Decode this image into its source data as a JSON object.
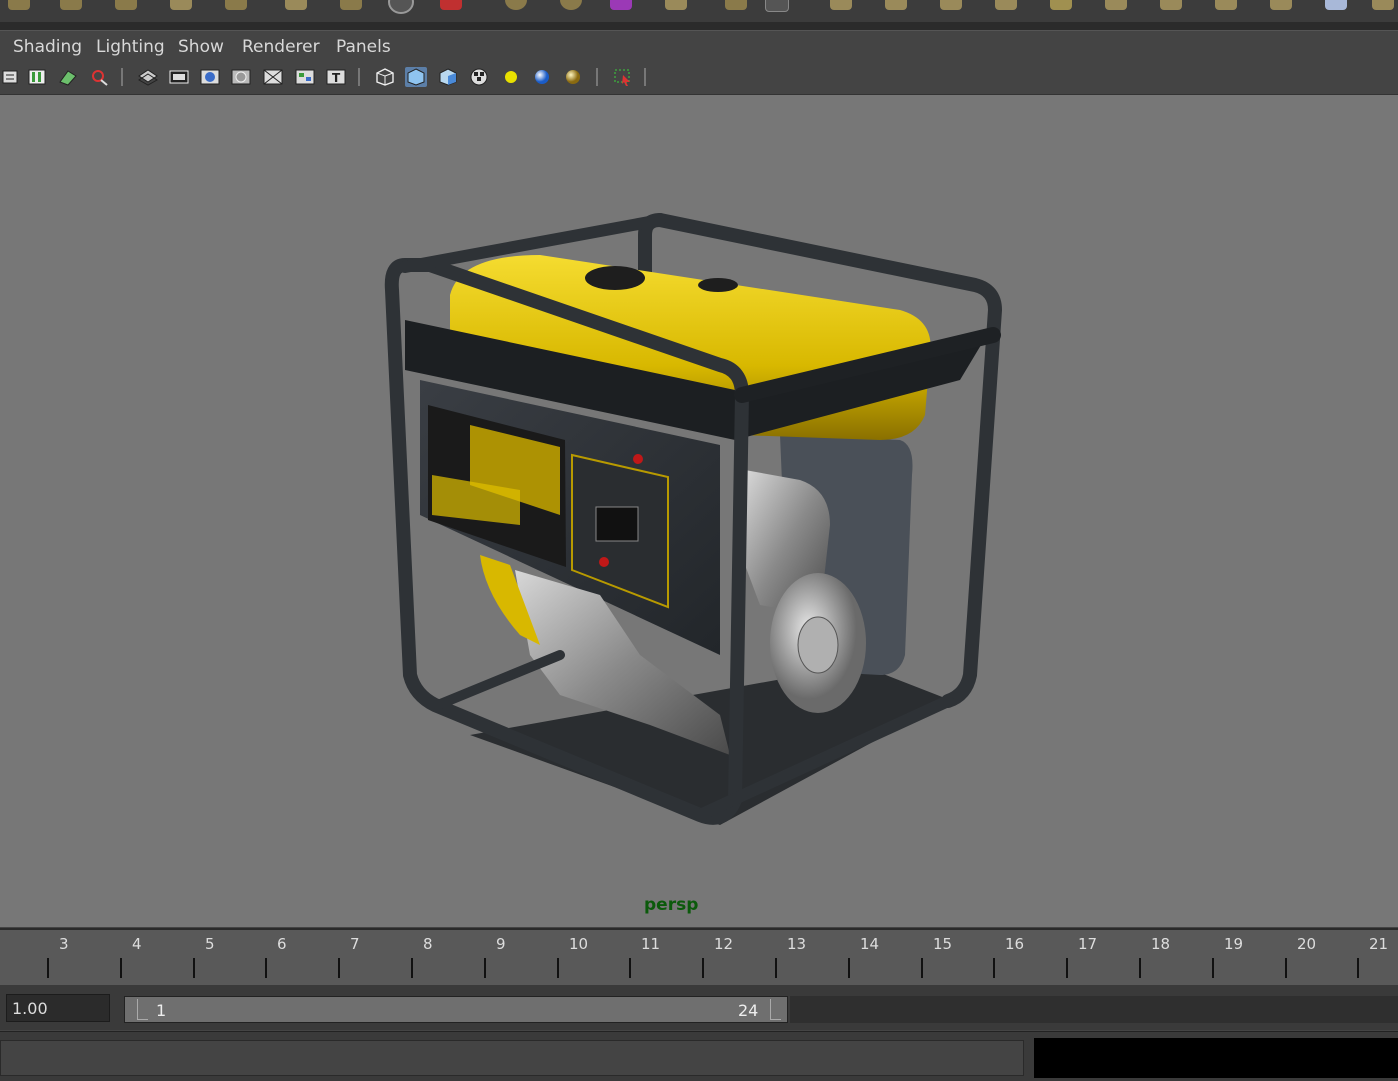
{
  "menu": {
    "items": [
      {
        "id": "shading",
        "label": "Shading"
      },
      {
        "id": "lighting",
        "label": "Lighting"
      },
      {
        "id": "show",
        "label": "Show"
      },
      {
        "id": "renderer",
        "label": "Renderer"
      },
      {
        "id": "panels",
        "label": "Panels"
      }
    ]
  },
  "toolbar": {
    "icons": [
      "camera-attributes-icon",
      "bookmarks-icon",
      "image-plane-icon",
      "2d-pan-zoom-icon",
      "grid-icon",
      "film-gate-icon",
      "resolution-gate-icon",
      "gate-mask-icon",
      "field-chart-icon",
      "safe-action-icon",
      "safe-title-icon",
      "wireframe-icon",
      "smooth-shade-icon",
      "default-material-icon",
      "textured-icon",
      "use-default-lights-icon",
      "shadows-icon",
      "ambient-occlusion-icon",
      "isolate-select-icon"
    ]
  },
  "viewport": {
    "camera_label": "persp"
  },
  "timeslider": {
    "ticks": [
      "3",
      "4",
      "5",
      "6",
      "7",
      "8",
      "9",
      "10",
      "11",
      "12",
      "13",
      "14",
      "15",
      "16",
      "17",
      "18",
      "19",
      "20",
      "21"
    ]
  },
  "range": {
    "current_time": "1.00",
    "start": "1",
    "end": "24"
  },
  "colors": {
    "viewport_bg": "#777777",
    "generator_body": "#e2c000",
    "frame": "#2e3236"
  }
}
